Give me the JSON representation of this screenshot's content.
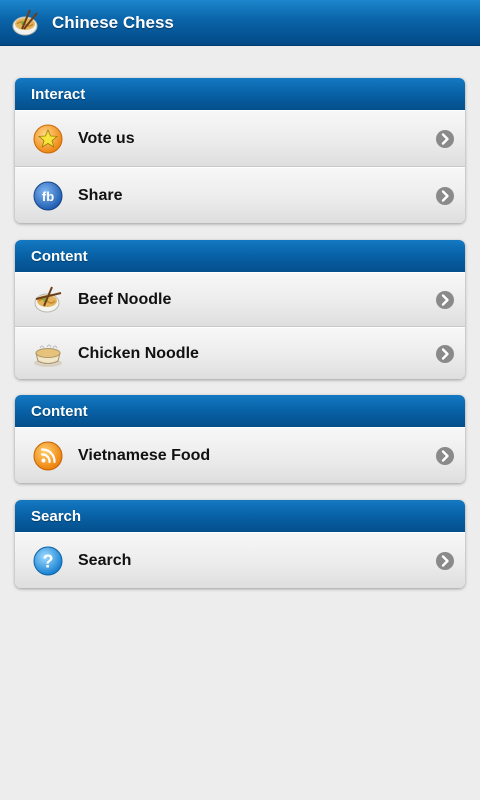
{
  "appbar": {
    "title": "Chinese Chess",
    "icon": "noodle-bowl-icon"
  },
  "groups": [
    {
      "header": "Interact",
      "items": [
        {
          "label": "Vote us",
          "icon": "star-badge-icon"
        },
        {
          "label": "Share",
          "icon": "facebook-icon"
        }
      ]
    },
    {
      "header": "Content",
      "items": [
        {
          "label": "Beef Noodle",
          "icon": "noodle-bowl-icon"
        },
        {
          "label": "Chicken Noodle",
          "icon": "soup-pot-icon"
        }
      ]
    },
    {
      "header": "Content",
      "items": [
        {
          "label": "Vietnamese Food",
          "icon": "rss-icon"
        }
      ]
    },
    {
      "header": "Search",
      "items": [
        {
          "label": "Search",
          "icon": "help-question-icon"
        }
      ]
    }
  ],
  "icon_glyphs": {
    "facebook": "fb",
    "question": "?"
  },
  "colors": {
    "header_blue": "#0861a6",
    "background": "#ededed",
    "chevron": "#8a8a8a",
    "star_orange": "#f39a1e",
    "rss_orange": "#f08a0a",
    "facebook_blue": "#2f6fc2",
    "question_blue": "#1e95e0"
  }
}
